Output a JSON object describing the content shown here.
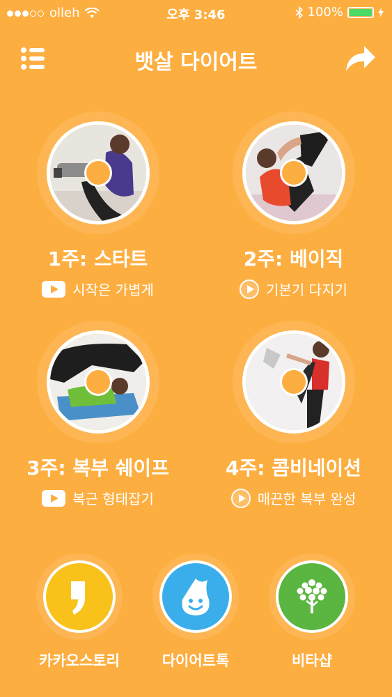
{
  "status": {
    "carrier": "olleh",
    "time": "오후 3:46",
    "battery": "100%",
    "battery_level": 1.0
  },
  "nav": {
    "title": "뱃살 다이어트",
    "menu_icon": "list-icon",
    "share_icon": "share-arrow-icon"
  },
  "weeks": [
    {
      "title": "1주: 스타트",
      "subtitle": "시작은 가볍게",
      "play_icon": "youtube-play-icon"
    },
    {
      "title": "2주: 베이직",
      "subtitle": "기본기 다지기",
      "play_icon": "play-circle-icon"
    },
    {
      "title": "3주: 복부 쉐이프",
      "subtitle": "복근 형태잡기",
      "play_icon": "youtube-play-icon"
    },
    {
      "title": "4주: 콤비네이션",
      "subtitle": "매끈한 복부 완성",
      "play_icon": "play-circle-icon"
    }
  ],
  "apps": [
    {
      "label": "카카오스토리",
      "color": "#F9C21B",
      "icon": "kakaostory-icon"
    },
    {
      "label": "다이어트톡",
      "color": "#3AAEEA",
      "icon": "droplet-face-icon"
    },
    {
      "label": "비타샵",
      "color": "#5BB541",
      "icon": "tree-icon"
    }
  ],
  "colors": {
    "background": "#FDAE40",
    "battery_fill": "#4CD964"
  }
}
